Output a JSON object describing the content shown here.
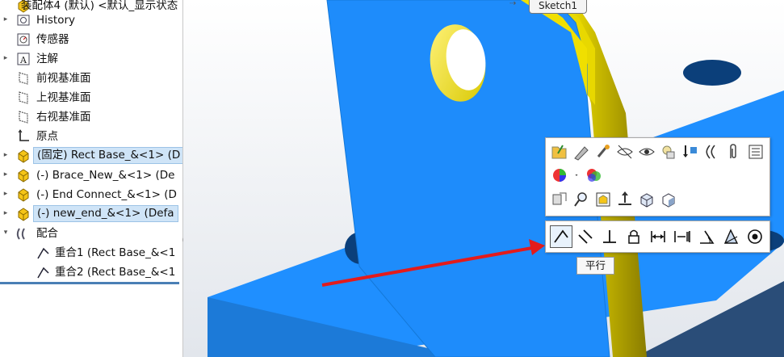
{
  "tree": {
    "root_label": "装配体4 (默认) <默认_显示状态",
    "items": [
      {
        "label": "History",
        "icon": "history-icon",
        "expander": true
      },
      {
        "label": "传感器",
        "icon": "sensor-icon",
        "expander": false
      },
      {
        "label": "注解",
        "icon": "annotation-icon",
        "expander": true
      },
      {
        "label": "前视基准面",
        "icon": "plane-icon",
        "expander": false
      },
      {
        "label": "上视基准面",
        "icon": "plane-icon",
        "expander": false
      },
      {
        "label": "右视基准面",
        "icon": "plane-icon",
        "expander": false
      },
      {
        "label": "原点",
        "icon": "origin-icon",
        "expander": false
      },
      {
        "label": "(固定) Rect Base_&<1> (D",
        "icon": "part-icon",
        "expander": true,
        "selected": true
      },
      {
        "label": "(-) Brace_New_&<1> (De",
        "icon": "part-icon",
        "expander": true
      },
      {
        "label": "(-) End Connect_&<1> (D",
        "icon": "part-icon",
        "expander": true
      },
      {
        "label": "(-) new_end_&<1> (Defa",
        "icon": "part-icon",
        "expander": true,
        "selected": true
      },
      {
        "label": "配合",
        "icon": "mates-folder-icon",
        "expander": true,
        "open": true
      },
      {
        "label": "重合1 (Rect Base_&<1",
        "icon": "coincident-mate-icon",
        "sub": true
      },
      {
        "label": "重合2 (Rect Base_&<1",
        "icon": "coincident-mate-icon",
        "sub": true
      }
    ]
  },
  "viewport": {
    "sketch_tag": "Sketch1"
  },
  "context_toolbar": {
    "rows": [
      [
        "open-part-icon",
        "edit-part-icon",
        "appearance-icon",
        "hide-icon",
        "change-transparency-icon",
        "isolate-icon",
        "insert-component-icon",
        "mate-icon",
        "paperclip-icon",
        "properties-icon"
      ],
      [
        "color-wheel-icon",
        "dropdown-arrow-icon",
        "appearance-edit-icon"
      ],
      [
        "move-component-icon",
        "zoom-to-selection-icon",
        "view-selection-icon",
        "normal-to-icon",
        "box-view-icon",
        "section-view-icon"
      ]
    ]
  },
  "mate_toolbar": {
    "buttons": [
      {
        "name": "parallel-mate-icon",
        "active": true
      },
      {
        "name": "coincident-mate-icon",
        "active": false
      },
      {
        "name": "perpendicular-mate-icon",
        "active": false
      },
      {
        "name": "lock-mate-icon",
        "active": false
      },
      {
        "name": "distance-mate-icon",
        "active": false
      },
      {
        "name": "width-mate-icon",
        "active": false
      },
      {
        "name": "angle-mate-icon",
        "active": false
      },
      {
        "name": "profile-center-mate-icon",
        "active": false
      },
      {
        "name": "concentric-mate-icon",
        "active": false
      }
    ],
    "tooltip": "平行"
  },
  "colors": {
    "part_blue": "#1e90ff",
    "part_edge_yellow": "#ffef00",
    "selection_bg": "#cfe4f7",
    "arrow_red": "#e31b1b"
  }
}
